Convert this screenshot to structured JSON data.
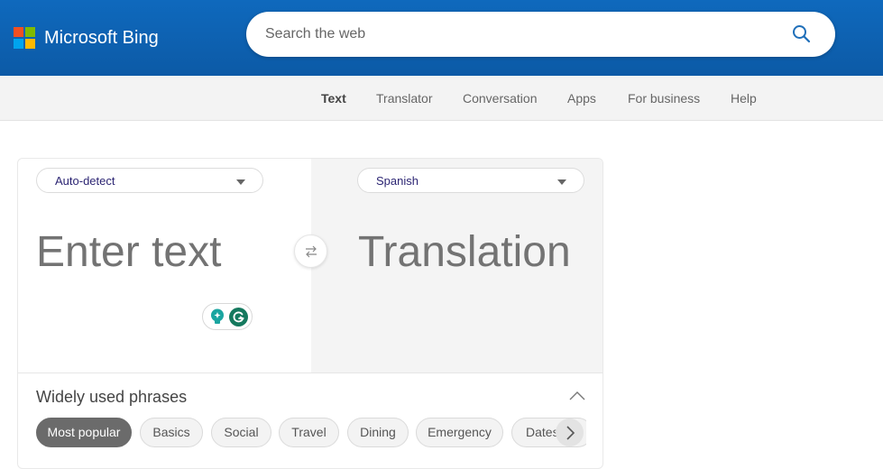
{
  "header": {
    "brand": "Microsoft Bing",
    "search_placeholder": "Search the web",
    "search_value": ""
  },
  "nav": {
    "items": [
      {
        "label": "Text",
        "active": true
      },
      {
        "label": "Translator"
      },
      {
        "label": "Conversation"
      },
      {
        "label": "Apps"
      },
      {
        "label": "For business"
      },
      {
        "label": "Help"
      }
    ]
  },
  "translator": {
    "source_language": "Auto-detect",
    "target_language": "Spanish",
    "input_placeholder": "Enter text",
    "output_placeholder": "Translation"
  },
  "phrases": {
    "title": "Widely used phrases",
    "categories": [
      {
        "label": "Most popular",
        "active": true
      },
      {
        "label": "Basics"
      },
      {
        "label": "Social"
      },
      {
        "label": "Travel"
      },
      {
        "label": "Dining"
      },
      {
        "label": "Emergency"
      },
      {
        "label": "Dates"
      }
    ]
  },
  "colors": {
    "header_blue": "#0f69bd",
    "language_text": "#2c2573",
    "active_chip": "#6b6b6b",
    "grammarly_green": "#15795e",
    "bulb_teal": "#1aa5a0"
  }
}
